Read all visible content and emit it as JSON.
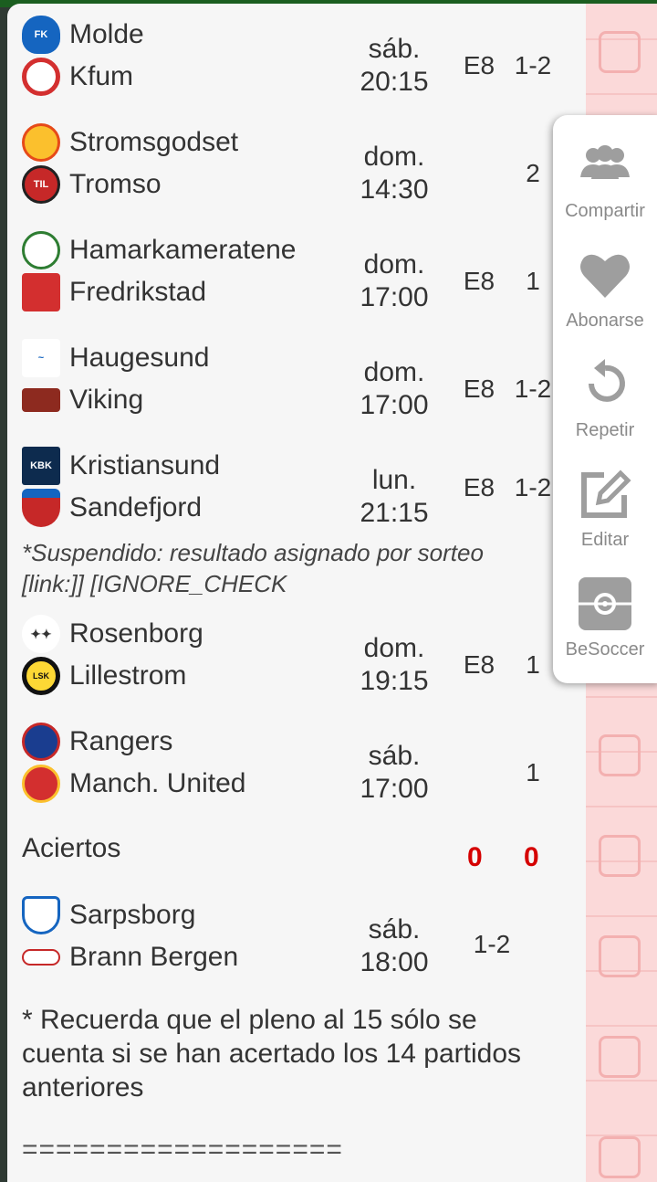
{
  "matches": [
    {
      "home": "Molde",
      "away": "Kfum",
      "day": "sáb.",
      "time": "20:15",
      "e": "E8",
      "result": "1-2",
      "home_logo": "molde-logo",
      "away_logo": "kfum-logo"
    },
    {
      "home": "Stromsgodset",
      "away": "Tromso",
      "day": "dom.",
      "time": "14:30",
      "e": "",
      "result": "2",
      "home_logo": "stromsgodset-logo",
      "away_logo": "tromso-logo"
    },
    {
      "home": "Hamarkameratene",
      "away": "Fredrikstad",
      "day": "dom.",
      "time": "17:00",
      "e": "E8",
      "result": "1",
      "home_logo": "hamarkameratene-logo",
      "away_logo": "fredrikstad-logo"
    },
    {
      "home": "Haugesund",
      "away": "Viking",
      "day": "dom.",
      "time": "17:00",
      "e": "E8",
      "result": "1-2",
      "home_logo": "haugesund-logo",
      "away_logo": "viking-logo"
    },
    {
      "home": "Kristiansund",
      "away": "Sandefjord",
      "day": "lun.",
      "time": "21:15",
      "e": "E8",
      "result": "1-2",
      "home_logo": "kristiansund-logo",
      "away_logo": "sandefjord-logo"
    },
    {
      "home": "Rosenborg",
      "away": "Lillestrom",
      "day": "dom.",
      "time": "19:15",
      "e": "E8",
      "result": "1",
      "home_logo": "rosenborg-logo",
      "away_logo": "lillestrom-logo"
    },
    {
      "home": "Rangers",
      "away": "Manch. United",
      "day": "sáb.",
      "time": "17:00",
      "e": "",
      "result": "1",
      "home_logo": "rangers-logo",
      "away_logo": "manchester-united-logo"
    }
  ],
  "suspended_note": "*Suspendido: resultado asignado por sorteo [link:]] [IGNORE_CHECK",
  "aciertos": {
    "label": "Aciertos",
    "value1": "0",
    "value2": "0"
  },
  "pleno": {
    "home": "Sarpsborg",
    "away": "Brann Bergen",
    "day": "sáb.",
    "time": "18:00",
    "result": "1-2",
    "home_logo": "sarpsborg-logo",
    "away_logo": "brann-logo"
  },
  "footnote": "* Recuerda que el pleno al 15 sólo se cuenta si se han acertado los 14 partidos anteriores",
  "separator": "===================",
  "menu": [
    {
      "label": "Compartir",
      "icon": "share-group-icon"
    },
    {
      "label": "Abonarse",
      "icon": "heart-icon"
    },
    {
      "label": "Repetir",
      "icon": "repeat-icon"
    },
    {
      "label": "Editar",
      "icon": "edit-icon"
    },
    {
      "label": "BeSoccer",
      "icon": "besoccer-icon"
    }
  ],
  "colors": {
    "accent_red": "#d50000",
    "menu_icon": "#9e9e9e",
    "pattern": "#fbd9d9"
  }
}
